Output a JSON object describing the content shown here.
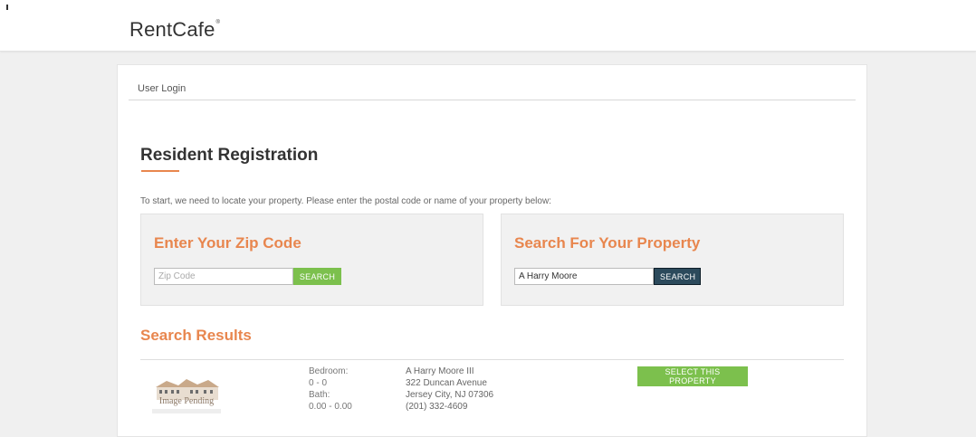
{
  "header": {
    "logo_text": "RentCafe",
    "logo_mark": "®"
  },
  "breadcrumb": {
    "label": "User Login"
  },
  "page": {
    "title": "Resident Registration",
    "intro": "To start, we need to locate your property. Please enter the postal code or name of your property below:"
  },
  "zip_panel": {
    "heading": "Enter Your Zip Code",
    "input_value": "",
    "input_placeholder": "Zip Code",
    "button_label": "SEARCH"
  },
  "property_panel": {
    "heading": "Search For Your Property",
    "input_value": "A Harry Moore",
    "button_label": "SEARCH"
  },
  "results": {
    "title": "Search Results",
    "items": [
      {
        "image_caption": "Image Pending",
        "bedroom_label": "Bedroom:",
        "bedroom_value": "0 - 0",
        "bath_label": "Bath:",
        "bath_value": "0.00 - 0.00",
        "name": "A Harry Moore III",
        "street": "322 Duncan Avenue",
        "city": "Jersey City, NJ 07306",
        "phone": "(201) 332-4609",
        "select_label": "SELECT THIS PROPERTY"
      }
    ]
  },
  "colors": {
    "accent_orange": "#e8864e",
    "button_green": "#7cc04d",
    "button_dark": "#2c4a5c"
  }
}
